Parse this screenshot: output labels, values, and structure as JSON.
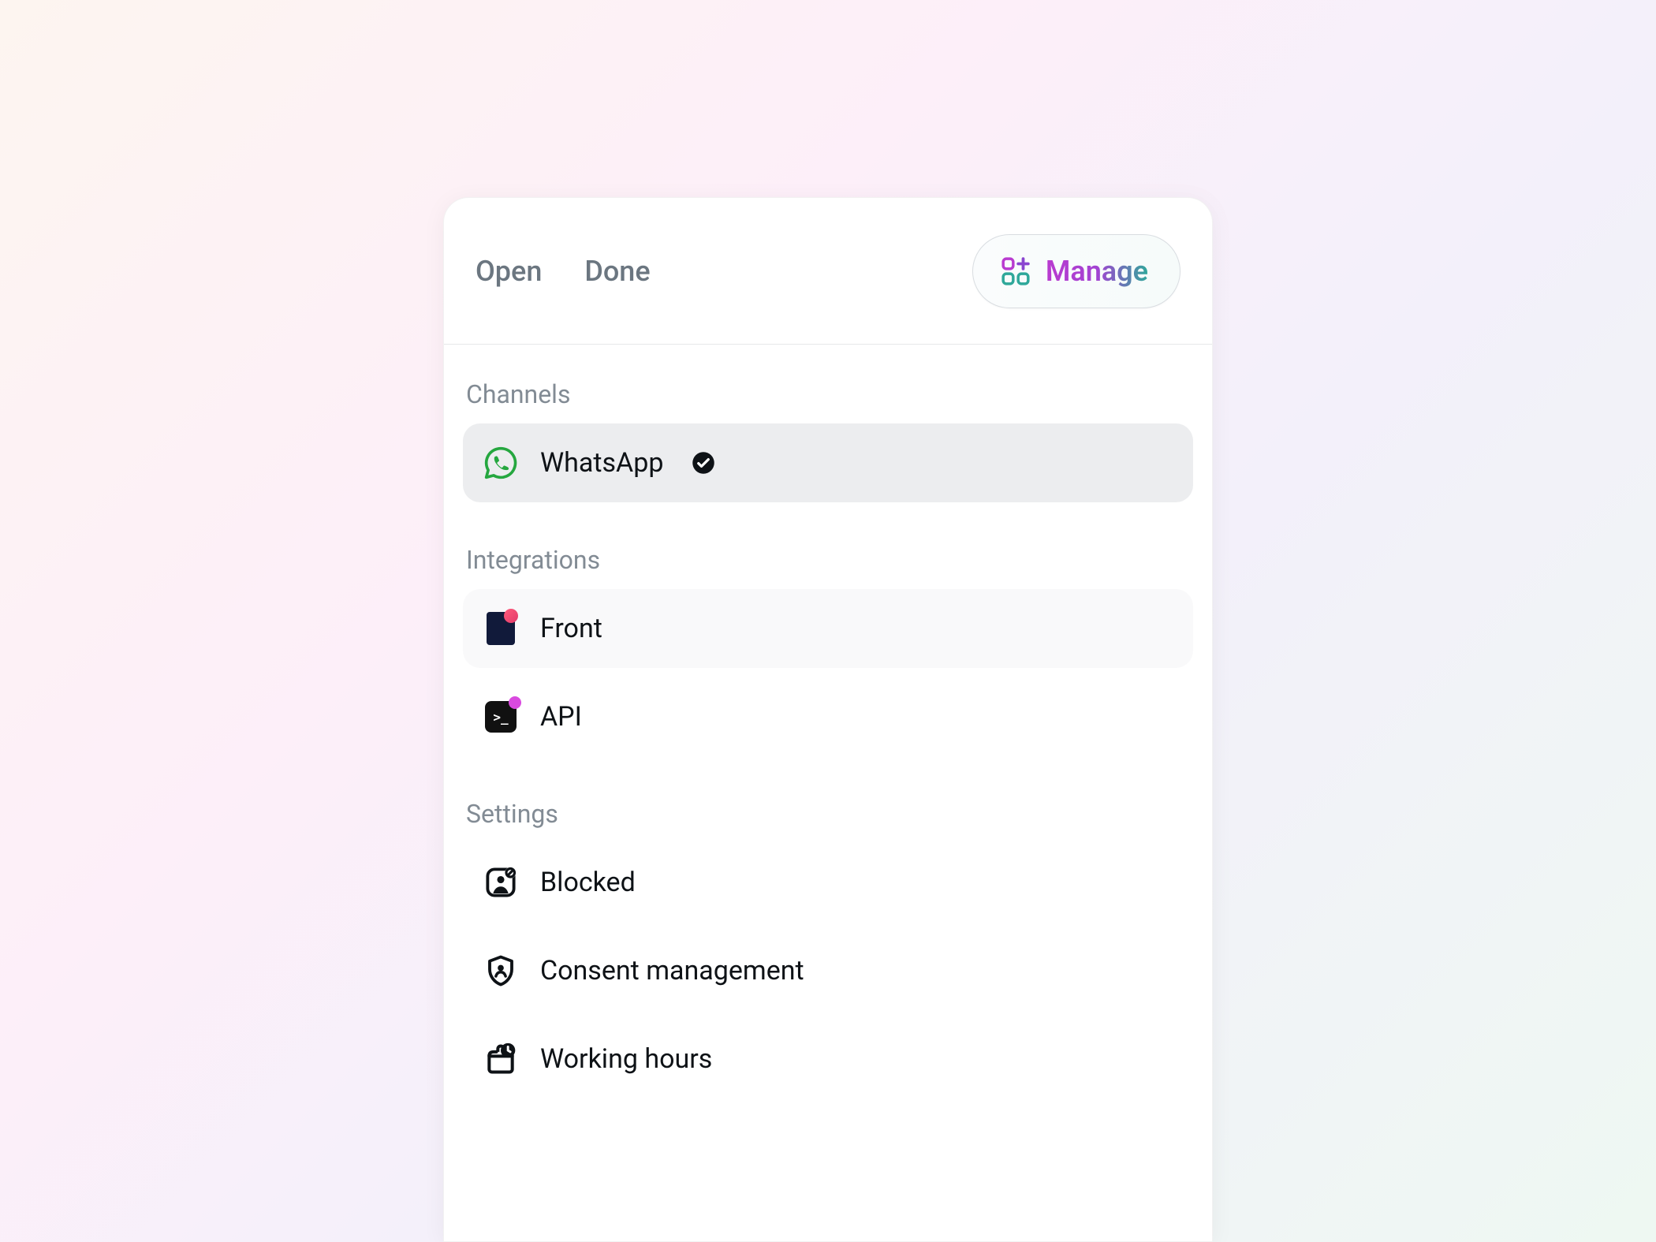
{
  "header": {
    "tabs": [
      "Open",
      "Done"
    ],
    "manage_label": "Manage"
  },
  "sections": {
    "channels": {
      "label": "Channels",
      "items": [
        {
          "label": "WhatsApp",
          "verified": true
        }
      ]
    },
    "integrations": {
      "label": "Integrations",
      "items": [
        {
          "label": "Front"
        },
        {
          "label": "API"
        }
      ]
    },
    "settings": {
      "label": "Settings",
      "items": [
        {
          "label": "Blocked"
        },
        {
          "label": "Consent management"
        },
        {
          "label": "Working hours"
        }
      ]
    }
  }
}
